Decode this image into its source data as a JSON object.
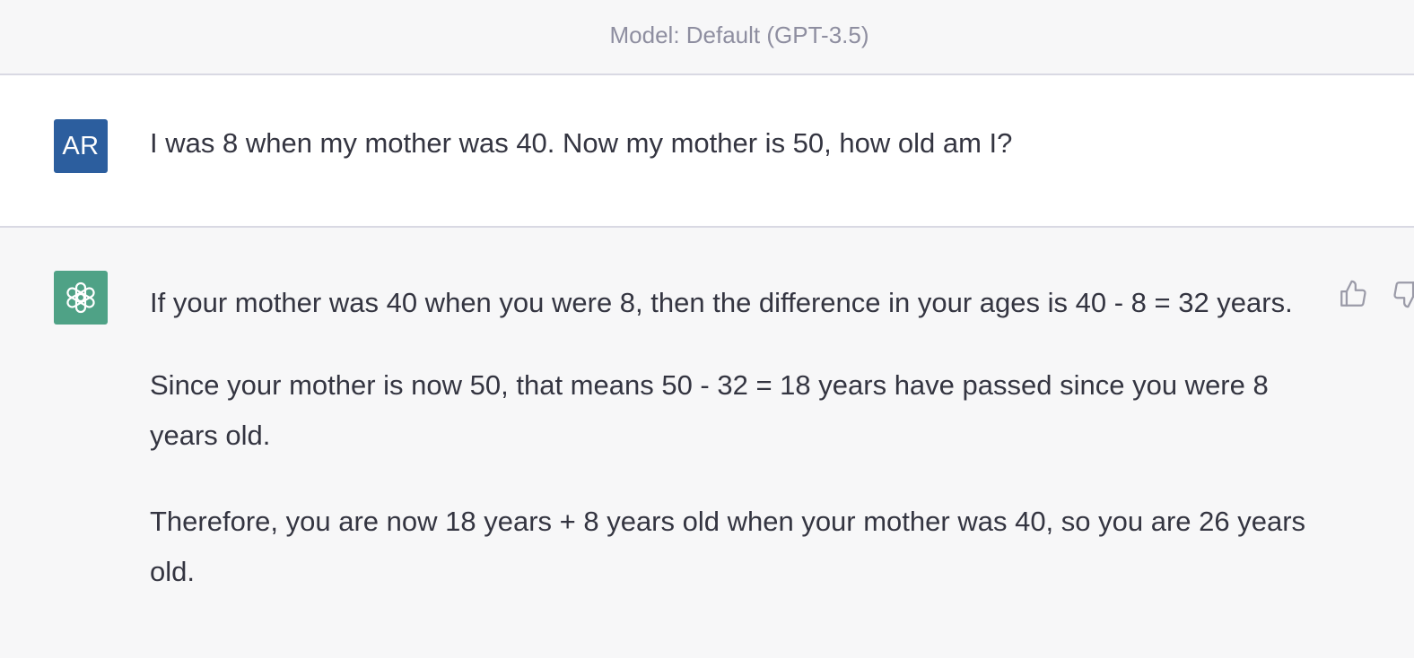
{
  "header": {
    "model_label": "Model: Default (GPT-3.5)"
  },
  "user_message": {
    "avatar_initials": "AR",
    "avatar_color": "#2c5e9e",
    "text": "I was 8 when my mother was 40. Now my mother is 50, how old am I?"
  },
  "assistant_message": {
    "avatar_icon": "openai-logo-icon",
    "avatar_color": "#4fa286",
    "paragraphs": [
      "If your mother was 40 when you were 8, then the difference in your ages is 40 - 8 = 32 years.",
      "Since your mother is now 50, that means 50 - 32 = 18 years have passed since you were 8 years old.",
      "Therefore, you are now 18 years + 8 years old when your mother was 40, so you are 26 years old."
    ],
    "actions": {
      "thumbs_up_icon": "thumbs-up-icon",
      "thumbs_down_icon": "thumbs-down-icon"
    }
  }
}
